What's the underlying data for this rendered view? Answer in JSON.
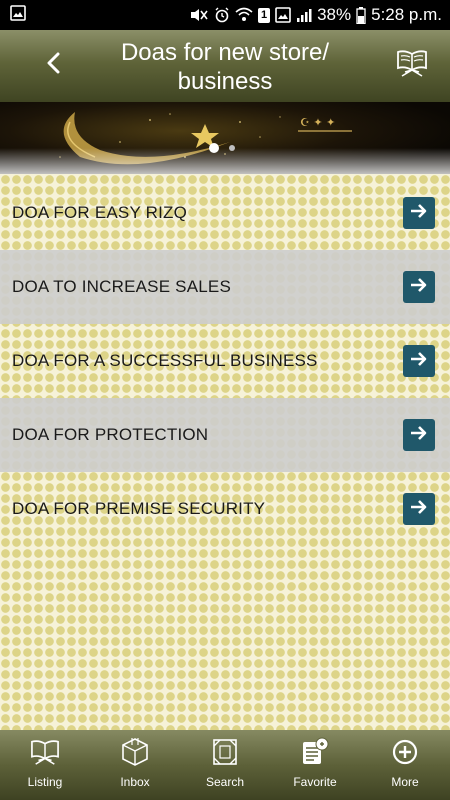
{
  "status_bar": {
    "sim": "1",
    "battery": "38%",
    "time": "5:28 p.m."
  },
  "header": {
    "title": "Doas for new store/ business",
    "back_icon": "chevron-left-icon",
    "book_icon": "open-book-icon"
  },
  "banner": {
    "slides": 2,
    "active_slide": 1
  },
  "list": {
    "items": [
      {
        "label": "DOA FOR EASY RIZQ"
      },
      {
        "label": "DOA TO INCREASE SALES"
      },
      {
        "label": "DOA FOR A SUCCESSFUL BUSINESS"
      },
      {
        "label": "DOA FOR PROTECTION"
      },
      {
        "label": "DOA FOR PREMISE SECURITY"
      }
    ],
    "arrow_icon": "arrow-right-icon"
  },
  "bottom_nav": {
    "items": [
      {
        "label": "Listing",
        "icon": "open-book-icon"
      },
      {
        "label": "Inbox",
        "icon": "box-icon"
      },
      {
        "label": "Search",
        "icon": "search-frame-icon"
      },
      {
        "label": "Favorite",
        "icon": "favorite-list-icon"
      },
      {
        "label": "More",
        "icon": "plus-circle-icon"
      }
    ]
  },
  "colors": {
    "header": "#5f6439",
    "arrow_button": "#20586a",
    "pattern_dot": "#ddd488",
    "row_shade": "#cdcdcd"
  }
}
